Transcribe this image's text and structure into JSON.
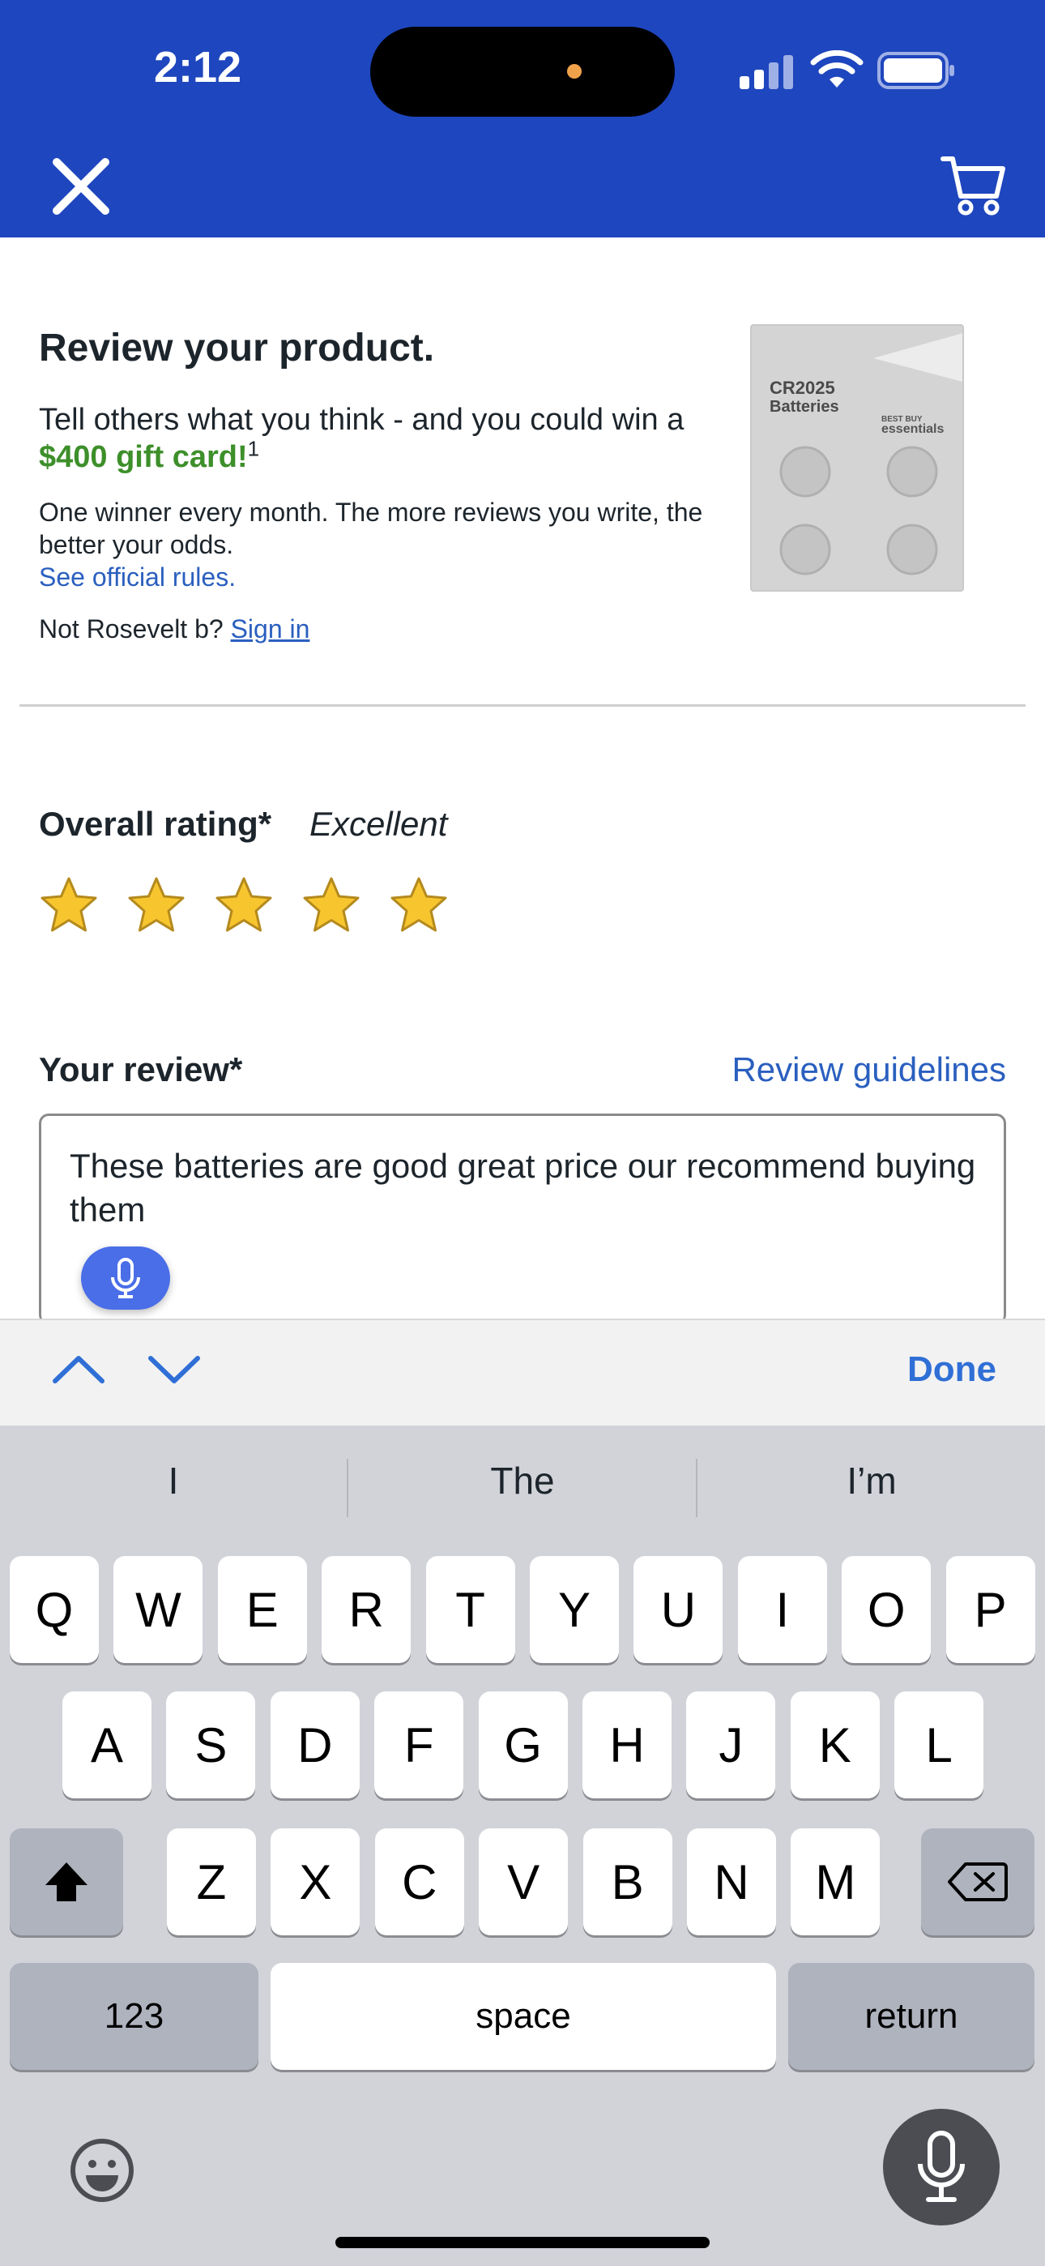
{
  "status_bar": {
    "time": "2:12"
  },
  "nav": {
    "close_icon": "close-icon",
    "cart_icon": "cart-icon"
  },
  "intro": {
    "title": "Review your product.",
    "text_pre": "Tell others what you think - and you could win a ",
    "gift": "$400 gift card!",
    "footnote": "1",
    "small_text": "One winner every month. The more reviews you write, the better your odds.",
    "rules_link": "See official rules.",
    "not_user": "Not Rosevelt b?",
    "sign_in": "Sign in"
  },
  "product": {
    "label1": "CR2025",
    "label2": "Batteries",
    "brand1": "BEST BUY",
    "brand2": "essentials"
  },
  "rating": {
    "label": "Overall rating*",
    "value": "Excellent",
    "stars": 5,
    "max": 5,
    "star_color": "#f7c62f"
  },
  "review": {
    "label": "Your review*",
    "guidelines": "Review guidelines",
    "text": "These batteries are good great price our recommend buying them"
  },
  "accessory": {
    "done": "Done"
  },
  "keyboard": {
    "suggestions": [
      "I",
      "The",
      "I’m"
    ],
    "row1": [
      "Q",
      "W",
      "E",
      "R",
      "T",
      "Y",
      "U",
      "I",
      "O",
      "P"
    ],
    "row2": [
      "A",
      "S",
      "D",
      "F",
      "G",
      "H",
      "J",
      "K",
      "L"
    ],
    "row3": [
      "Z",
      "X",
      "C",
      "V",
      "B",
      "N",
      "M"
    ],
    "numbers": "123",
    "space": "space",
    "return": "return"
  },
  "colors": {
    "brand_blue": "#1e46be",
    "link": "#2a5fbf",
    "gift_green": "#3d8f2a"
  }
}
